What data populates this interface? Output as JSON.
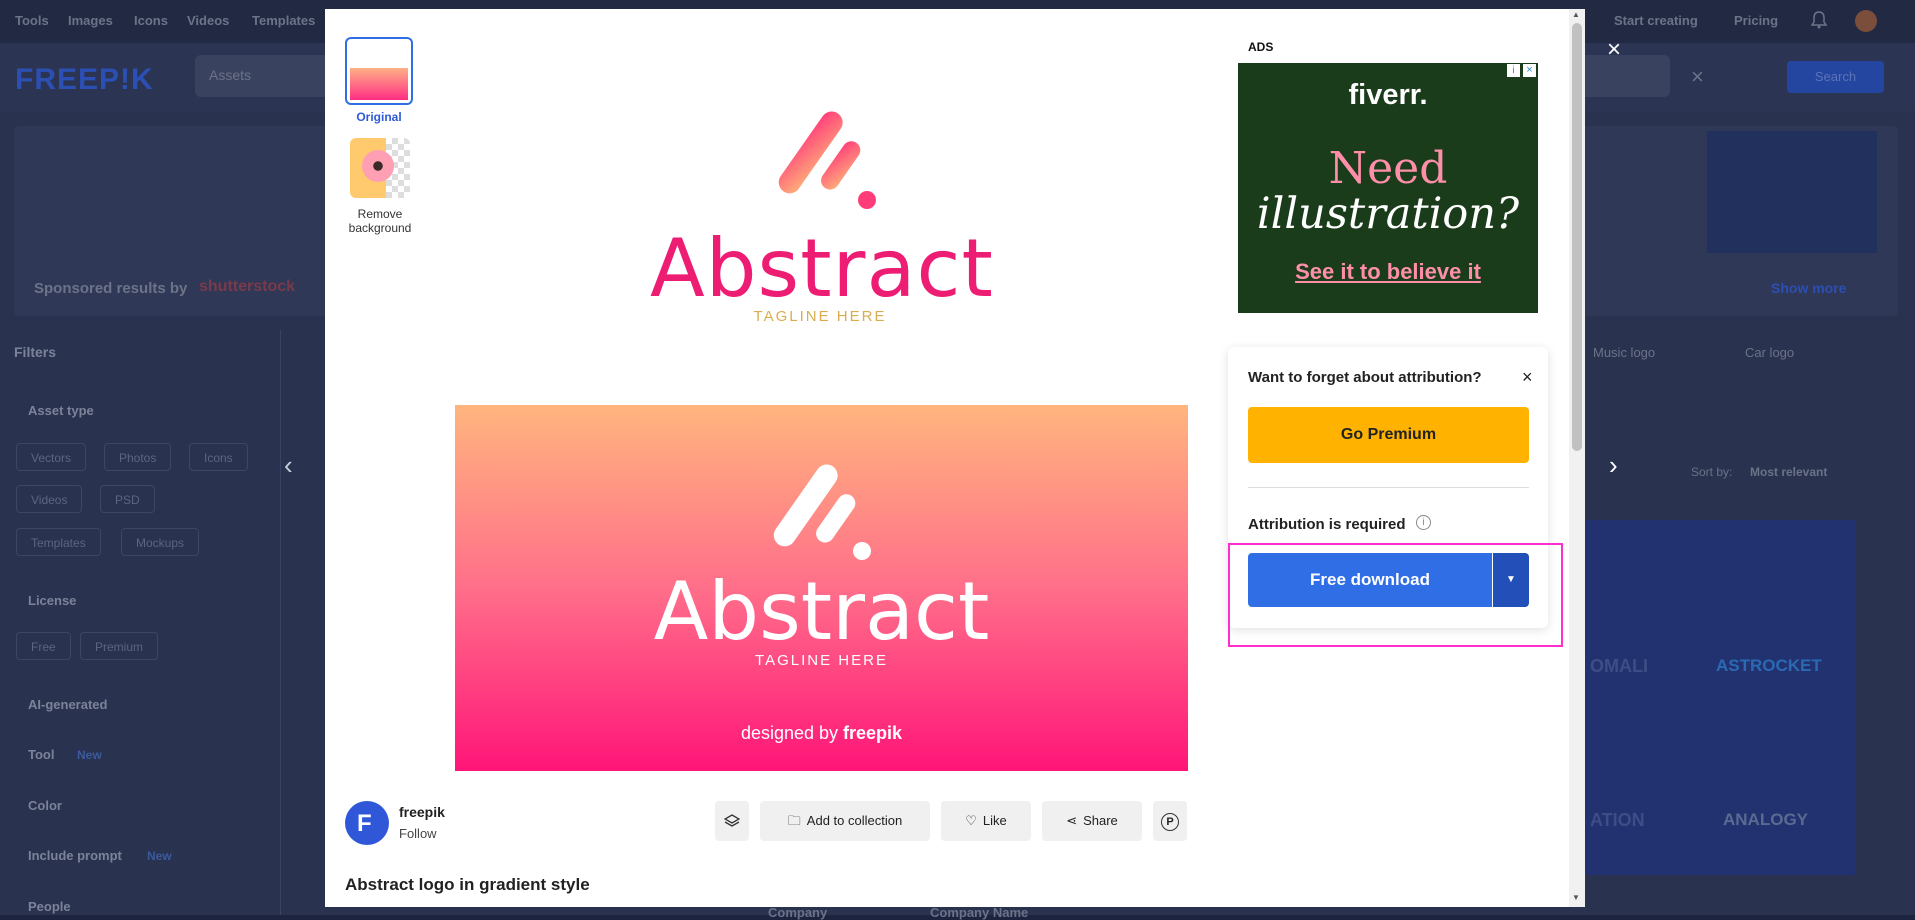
{
  "background": {
    "nav": [
      "Tools",
      "Images",
      "Icons",
      "Videos",
      "Templates",
      "Start creating",
      "Pricing"
    ],
    "logo": "FREEP!K",
    "search_mode": "Assets",
    "search_button": "Search",
    "sponsored_label": "Sponsored results by",
    "sponsored_brand": "shutterstock",
    "show_more": "Show more",
    "filters_label": "Filters",
    "filters": [
      {
        "label": "Asset type",
        "chips": [
          "Vectors",
          "Photos",
          "Icons",
          "Videos",
          "PSD",
          "Templates",
          "Mockups"
        ]
      },
      {
        "label": "License",
        "chips": [
          "Free",
          "Premium"
        ]
      },
      {
        "label": "AI-generated"
      },
      {
        "label": "Tool",
        "badge": "New"
      },
      {
        "label": "Color"
      },
      {
        "label": "Include prompt",
        "badge": "New"
      },
      {
        "label": "People"
      }
    ],
    "related": [
      "Music logo",
      "Car logo"
    ],
    "sort_label": "Sort by:",
    "sort_value": "Most relevant",
    "grid_texts": [
      "OMALI",
      "ASTROCKET",
      "ATION",
      "ANALOGY"
    ],
    "bottom_texts": [
      "Company",
      "Company Name"
    ]
  },
  "modal": {
    "thumbnails": [
      {
        "label": "Original",
        "active": true
      },
      {
        "label": "Remove background",
        "active": false
      }
    ],
    "preview": {
      "top_logo_word": "Abstract",
      "top_tagline": "TAGLINE HERE",
      "bottom_logo_word": "Abstract",
      "bottom_tagline": "TAGLINE HERE",
      "credit": "designed by",
      "credit_brand": "freepik"
    },
    "ads": {
      "label": "ADS",
      "brand": "fiverr.",
      "line1": "Need",
      "line2": "illustration?",
      "cta": "See it to believe it"
    },
    "attribution": {
      "question": "Want to forget about attribution?",
      "go_premium": "Go Premium",
      "required": "Attribution is required",
      "free_download": "Free download"
    },
    "author": {
      "name": "freepik",
      "follow": "Follow"
    },
    "actions": {
      "collection": "Add to collection",
      "like": "Like",
      "share": "Share"
    },
    "title": "Abstract logo in gradient style"
  },
  "colors": {
    "accent": "#2f6ee5",
    "premium": "#ffb300",
    "logo_pink": "#ee1d74",
    "highlight": "#ff2ed1"
  }
}
